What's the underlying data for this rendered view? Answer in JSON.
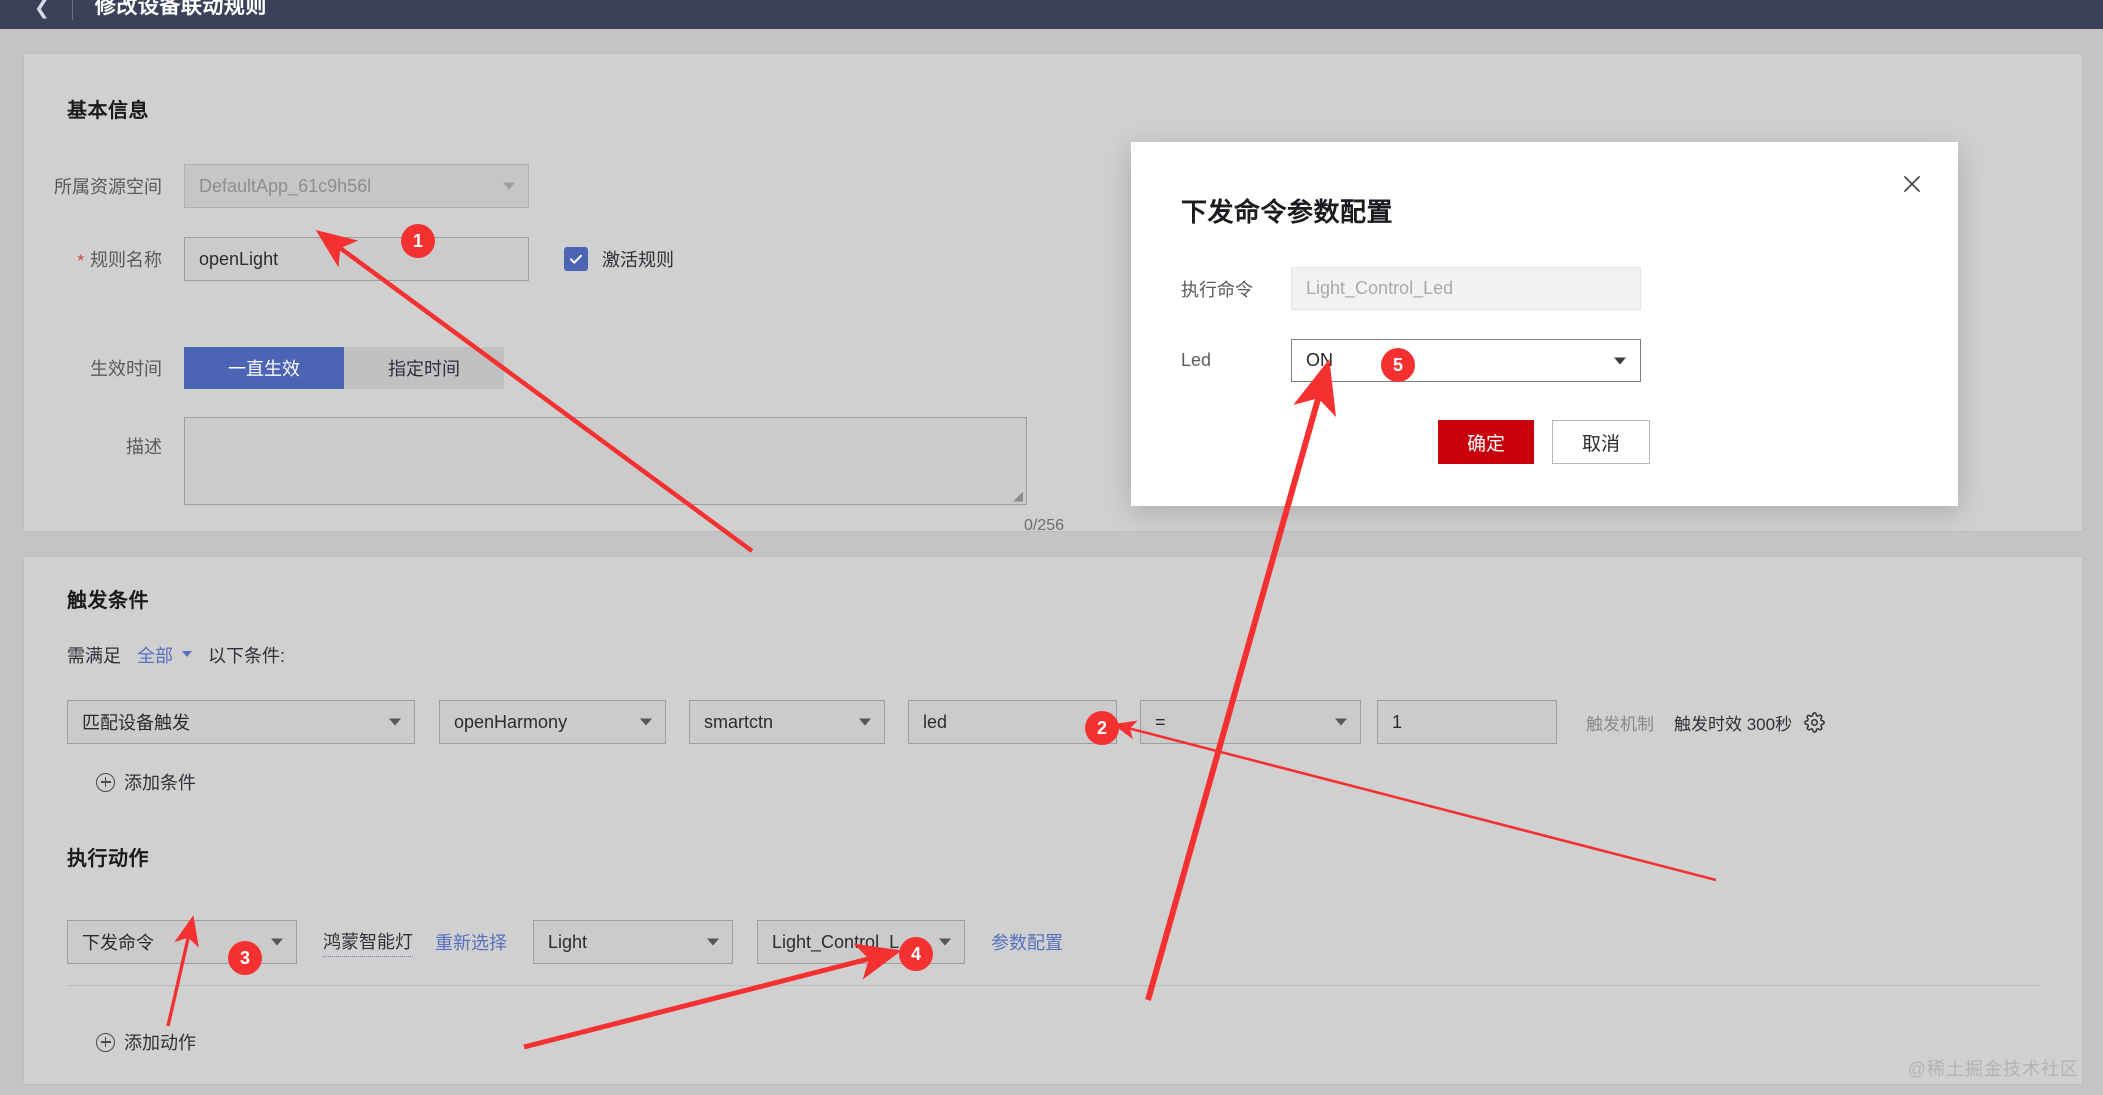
{
  "topbar": {
    "back_icon": "chevron-left-icon",
    "title": "修改设备联动规则"
  },
  "basic": {
    "section_title": "基本信息",
    "space_label": "所属资源空间",
    "space_value": "DefaultApp_61c9h56l",
    "rule_name_label": "规则名称",
    "rule_name_required": "*",
    "rule_name_value": "openLight",
    "activate_label": "激活规则",
    "activate_checked": true,
    "effect_time_label": "生效时间",
    "effect_always": "一直生效",
    "effect_specified": "指定时间",
    "desc_label": "描述",
    "desc_value": "",
    "desc_counter": "0/256"
  },
  "trigger": {
    "section_title": "触发条件",
    "prefix": "需满足",
    "match_mode": "全部",
    "suffix": "以下条件:",
    "row": {
      "source": "匹配设备触发",
      "product": "openHarmony",
      "device": "smartctn",
      "property": "led",
      "operator": "=",
      "value": "1"
    },
    "mechanism_label": "触发机制",
    "validity_label": "触发时效 300秒",
    "gear_icon": "gear-icon",
    "add_condition": "添加条件"
  },
  "action": {
    "section_title": "执行动作",
    "type": "下发命令",
    "device_name": "鸿蒙智能灯",
    "reselect": "重新选择",
    "service": "Light",
    "command": "Light_Control_L...",
    "param_config": "参数配置",
    "add_action": "添加动作"
  },
  "modal": {
    "title": "下发命令参数配置",
    "close_icon": "close-icon",
    "command_label": "执行命令",
    "command_placeholder": "Light_Control_Led",
    "led_label": "Led",
    "led_value": "ON",
    "confirm": "确定",
    "cancel": "取消"
  },
  "annotations": {
    "badge1": "1",
    "badge2": "2",
    "badge3": "3",
    "badge4": "4",
    "badge5": "5"
  },
  "watermark": "@稀土掘金技术社区",
  "colors": {
    "header_bg": "#3b4159",
    "page_bg": "#c4c4c6",
    "card_bg": "#d0d0d1",
    "accent_blue": "#4b64b4",
    "link_blue": "#5671bd",
    "danger_red": "#c7000b",
    "anno_red": "#f43030"
  }
}
